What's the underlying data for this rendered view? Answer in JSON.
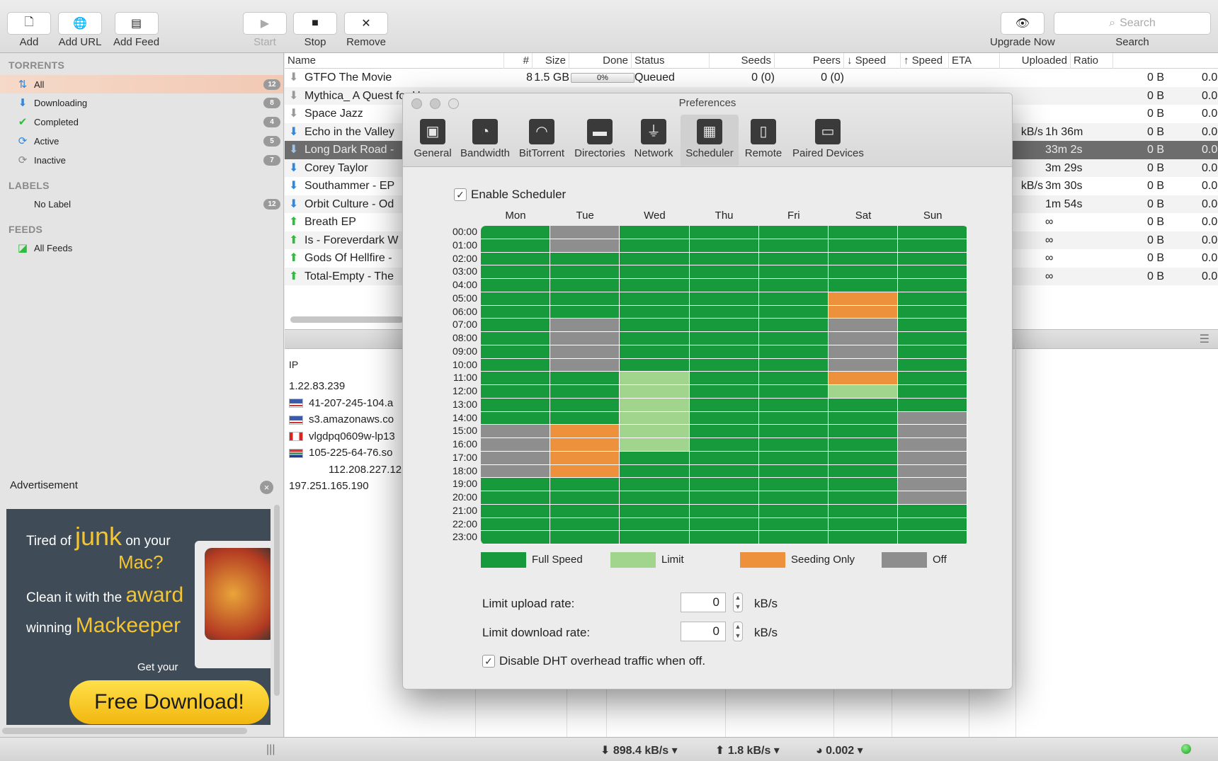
{
  "toolbar": {
    "add": "Add",
    "add_url": "Add URL",
    "add_feed": "Add Feed",
    "start": "Start",
    "stop": "Stop",
    "remove": "Remove",
    "upgrade": "Upgrade Now",
    "search_placeholder": "Search",
    "search_label": "Search"
  },
  "sidebar": {
    "torrents_header": "TORRENTS",
    "items": [
      {
        "label": "All",
        "count": "12"
      },
      {
        "label": "Downloading",
        "count": "8"
      },
      {
        "label": "Completed",
        "count": "4"
      },
      {
        "label": "Active",
        "count": "5"
      },
      {
        "label": "Inactive",
        "count": "7"
      }
    ],
    "labels_header": "LABELS",
    "labels": [
      {
        "label": "No Label",
        "count": "12"
      }
    ],
    "feeds_header": "FEEDS",
    "feeds": [
      {
        "label": "All Feeds"
      }
    ]
  },
  "ad": {
    "title": "Advertisement",
    "line1a": "Tired of",
    "line1b": "junk",
    "line1c": "on your",
    "line1d": "Mac?",
    "line2a": "Clean it with the",
    "line2b": "award",
    "line3a": "winning",
    "line3b": "Mackeeper",
    "getyour": "Get your",
    "cta": "Free Download!"
  },
  "table": {
    "columns": [
      "Name",
      "#",
      "Size",
      "Done",
      "Status",
      "Seeds",
      "Peers",
      "↓ Speed",
      "↑ Speed",
      "ETA",
      "Uploaded",
      "Ratio"
    ],
    "rows": [
      {
        "dir": "q",
        "name": "GTFO The Movie",
        "num": "8",
        "size": "1.5 GB",
        "done": "0%",
        "status": "Queued",
        "seeds": "0 (0)",
        "peers": "0 (0)",
        "dl": "",
        "eta": "",
        "uploaded": "0 B",
        "ratio": "0.0"
      },
      {
        "dir": "q",
        "name": "Mythica_ A Quest for H",
        "num": "",
        "size": "",
        "done": "",
        "status": "",
        "seeds": "",
        "peers": "",
        "dl": "",
        "eta": "",
        "uploaded": "0 B",
        "ratio": "0.0"
      },
      {
        "dir": "q",
        "name": "Space Jazz",
        "num": "",
        "size": "",
        "done": "",
        "status": "",
        "seeds": "",
        "peers": "",
        "dl": "",
        "eta": "",
        "uploaded": "0 B",
        "ratio": "0.0"
      },
      {
        "dir": "d",
        "name": "Echo in the Valley",
        "num": "",
        "size": "",
        "done": "",
        "status": "",
        "seeds": "",
        "peers": "",
        "dl": "kB/s",
        "eta": "1h 36m",
        "uploaded": "0 B",
        "ratio": "0.0"
      },
      {
        "dir": "d",
        "name": "Long Dark Road -",
        "num": "",
        "size": "",
        "done": "",
        "status": "",
        "seeds": "",
        "peers": "",
        "dl": "",
        "eta": "33m 2s",
        "uploaded": "0 B",
        "ratio": "0.0"
      },
      {
        "dir": "d",
        "name": "Corey Taylor",
        "num": "",
        "size": "",
        "done": "",
        "status": "",
        "seeds": "",
        "peers": "",
        "dl": "",
        "eta": "3m 29s",
        "uploaded": "0 B",
        "ratio": "0.0"
      },
      {
        "dir": "d",
        "name": "Southammer - EP",
        "num": "",
        "size": "",
        "done": "",
        "status": "",
        "seeds": "",
        "peers": "",
        "dl": "kB/s",
        "eta": "3m 30s",
        "uploaded": "0 B",
        "ratio": "0.0"
      },
      {
        "dir": "d",
        "name": "Orbit Culture - Od",
        "num": "",
        "size": "",
        "done": "",
        "status": "",
        "seeds": "",
        "peers": "",
        "dl": "",
        "eta": "1m 54s",
        "uploaded": "0 B",
        "ratio": "0.0"
      },
      {
        "dir": "u",
        "name": "Breath EP",
        "num": "",
        "size": "",
        "done": "",
        "status": "",
        "seeds": "",
        "peers": "",
        "dl": "",
        "eta": "∞",
        "uploaded": "0 B",
        "ratio": "0.0"
      },
      {
        "dir": "u",
        "name": "Is - Foreverdark W",
        "num": "",
        "size": "",
        "done": "",
        "status": "",
        "seeds": "",
        "peers": "",
        "dl": "",
        "eta": "∞",
        "uploaded": "0 B",
        "ratio": "0.0"
      },
      {
        "dir": "u",
        "name": "Gods Of Hellfire -",
        "num": "",
        "size": "",
        "done": "",
        "status": "",
        "seeds": "",
        "peers": "",
        "dl": "",
        "eta": "∞",
        "uploaded": "0 B",
        "ratio": "0.0"
      },
      {
        "dir": "u",
        "name": "Total-Empty - The",
        "num": "",
        "size": "",
        "done": "",
        "status": "",
        "seeds": "",
        "peers": "",
        "dl": "",
        "eta": "∞",
        "uploaded": "0 B",
        "ratio": "0.0"
      }
    ]
  },
  "peers": {
    "header": "IP",
    "rows": [
      {
        "flag": "",
        "ip": "1.22.83.239"
      },
      {
        "flag": "us",
        "ip": "41-207-245-104.a"
      },
      {
        "flag": "us",
        "ip": "s3.amazonaws.co"
      },
      {
        "flag": "ca",
        "ip": "vlgdpq0609w-lp13"
      },
      {
        "flag": "za",
        "ip": "105-225-64-76.so"
      },
      {
        "flag": "",
        "ip": "112.208.227.126.p"
      },
      {
        "flag": "",
        "ip": "197.251.165.190"
      }
    ]
  },
  "status": {
    "down": "898.4 kB/s",
    "up": "1.8 kB/s",
    "ratio": "0.002"
  },
  "prefs": {
    "title": "Preferences",
    "tabs": [
      {
        "label": "General",
        "icon": "general-icon"
      },
      {
        "label": "Bandwidth",
        "icon": "bandwidth-icon"
      },
      {
        "label": "BitTorrent",
        "icon": "bittorrent-icon"
      },
      {
        "label": "Directories",
        "icon": "folder-icon"
      },
      {
        "label": "Network",
        "icon": "plug-icon"
      },
      {
        "label": "Scheduler",
        "icon": "calendar-icon"
      },
      {
        "label": "Remote",
        "icon": "phone-icon"
      },
      {
        "label": "Paired Devices",
        "icon": "monitor-icon"
      }
    ],
    "selected_tab": "Scheduler",
    "enable_label": "Enable Scheduler",
    "days": [
      "Mon",
      "Tue",
      "Wed",
      "Thu",
      "Fri",
      "Sat",
      "Sun"
    ],
    "hours": [
      "00:00",
      "01:00",
      "02:00",
      "03:00",
      "04:00",
      "05:00",
      "06:00",
      "07:00",
      "08:00",
      "09:00",
      "10:00",
      "11:00",
      "12:00",
      "13:00",
      "14:00",
      "15:00",
      "16:00",
      "17:00",
      "18:00",
      "19:00",
      "20:00",
      "21:00",
      "22:00",
      "23:00"
    ],
    "colors": {
      "F": "#179a3c",
      "L": "#a1d48c",
      "S": "#ee913c",
      "O": "#8e8e8e"
    },
    "schedule": [
      "FOFFFFF",
      "FOFFFFF",
      "FFFFFFF",
      "FFFFFFF",
      "FFFFFFF",
      "FFFFFSF",
      "FFFFFSF",
      "FOFFFOF",
      "FOFFFOF",
      "FOFFFOF",
      "FOFFFOF",
      "FFLFFSF",
      "FFLFFLF",
      "FFLFFFF",
      "FFLFFFO",
      "OSLFFFO",
      "OSLFFFO",
      "OSFFFFO",
      "OSFFFFO",
      "FFFFFFO",
      "FFFFFFO",
      "FFFFFFF",
      "FFFFFFF",
      "FFFFFFF"
    ],
    "legend": [
      {
        "key": "F",
        "label": "Full Speed"
      },
      {
        "key": "L",
        "label": "Limit"
      },
      {
        "key": "S",
        "label": "Seeding Only"
      },
      {
        "key": "O",
        "label": "Off"
      }
    ],
    "upload_label": "Limit upload rate:",
    "upload_value": "0",
    "upload_unit": "kB/s",
    "download_label": "Limit download rate:",
    "download_value": "0",
    "download_unit": "kB/s",
    "dht_label": "Disable DHT overhead traffic when off."
  }
}
